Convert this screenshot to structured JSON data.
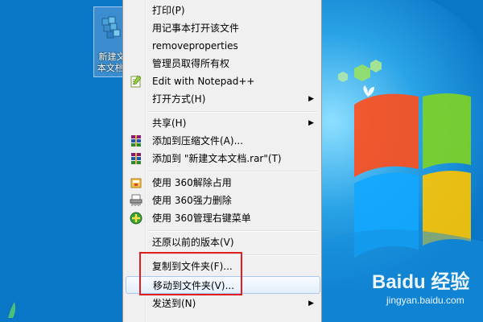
{
  "desktop": {
    "icon_label": "新建文本文档.txt"
  },
  "menu": {
    "items": [
      {
        "label": "打印(P)",
        "icon": "none",
        "submenu": false
      },
      {
        "label": "用记事本打开该文件",
        "icon": "none",
        "submenu": false
      },
      {
        "label": "removeproperties",
        "icon": "none",
        "submenu": false
      },
      {
        "label": "管理员取得所有权",
        "icon": "none",
        "submenu": false
      },
      {
        "label": "Edit with Notepad++",
        "icon": "notepad-plus-plus-icon",
        "submenu": false
      },
      {
        "label": "打开方式(H)",
        "icon": "none",
        "submenu": true
      },
      {
        "label": "共享(H)",
        "icon": "none",
        "submenu": true
      },
      {
        "label": "添加到压缩文件(A)...",
        "icon": "winrar-icon",
        "submenu": false
      },
      {
        "label": "添加到 \"新建文本文档.rar\"(T)",
        "icon": "winrar-icon",
        "submenu": false
      },
      {
        "label": "使用 360解除占用",
        "icon": "360-unlock-icon",
        "submenu": false
      },
      {
        "label": "使用 360强力删除",
        "icon": "360-shred-icon",
        "submenu": false
      },
      {
        "label": "使用 360管理右键菜单",
        "icon": "360-menu-manager-icon",
        "submenu": false
      },
      {
        "label": "还原以前的版本(V)",
        "icon": "none",
        "submenu": false
      },
      {
        "label": "复制到文件夹(F)...",
        "icon": "none",
        "submenu": false
      },
      {
        "label": "移动到文件夹(V)...",
        "icon": "none",
        "submenu": false,
        "highlighted": true
      },
      {
        "label": "发送到(N)",
        "icon": "none",
        "submenu": true
      }
    ],
    "submenu_arrow": "▶"
  },
  "watermark": {
    "logo": "Baidu 经验",
    "url": "jingyan.baidu.com"
  },
  "colors": {
    "highlight_box": "#e11d1d",
    "menu_background": "#f0f0f0",
    "desktop_background": "#0a76c6"
  }
}
